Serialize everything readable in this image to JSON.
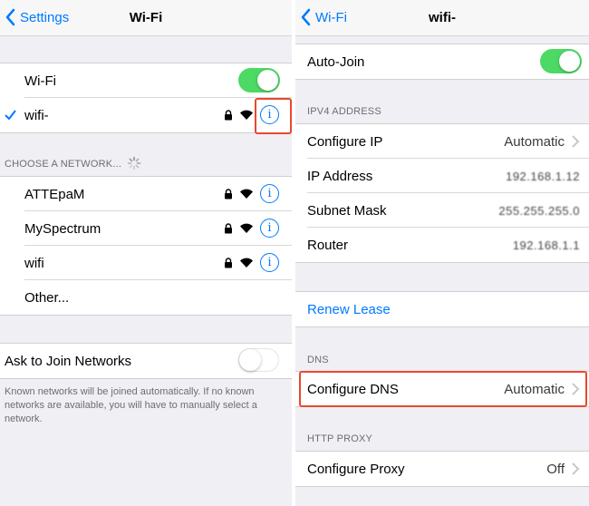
{
  "left": {
    "back_label": "Settings",
    "title": "Wi-Fi",
    "wifi_label": "Wi-Fi",
    "wifi_on": true,
    "connected_network": "wifi-",
    "section_header": "CHOOSE A NETWORK...",
    "networks": [
      {
        "name": "ATTEpaM"
      },
      {
        "name": "MySpectrum"
      },
      {
        "name": "wifi"
      }
    ],
    "other_label": "Other...",
    "ask_join_label": "Ask to Join Networks",
    "ask_join_on": false,
    "footnote": "Known networks will be joined automatically. If no known networks are available, you will have to manually select a network."
  },
  "right": {
    "back_label": "Wi-Fi",
    "title": "wifi-",
    "autojoin_label": "Auto-Join",
    "autojoin_on": true,
    "ipv4_header": "IPV4 ADDRESS",
    "configure_ip_label": "Configure IP",
    "configure_ip_value": "Automatic",
    "ip_address_label": "IP Address",
    "ip_address_value": "192.168.1.12",
    "subnet_label": "Subnet Mask",
    "subnet_value": "255.255.255.0",
    "router_label": "Router",
    "router_value": "192.168.1.1",
    "renew_label": "Renew Lease",
    "dns_header": "DNS",
    "configure_dns_label": "Configure DNS",
    "configure_dns_value": "Automatic",
    "proxy_header": "HTTP PROXY",
    "configure_proxy_label": "Configure Proxy",
    "configure_proxy_value": "Off"
  },
  "colors": {
    "accent": "#007aff",
    "toggle_on": "#4cd964",
    "highlight": "#e8492f",
    "background": "#efeff4"
  },
  "icons": [
    "chevron-left-icon",
    "checkmark-icon",
    "lock-icon",
    "wifi-icon",
    "info-icon",
    "chevron-right-icon",
    "spinner-icon"
  ]
}
